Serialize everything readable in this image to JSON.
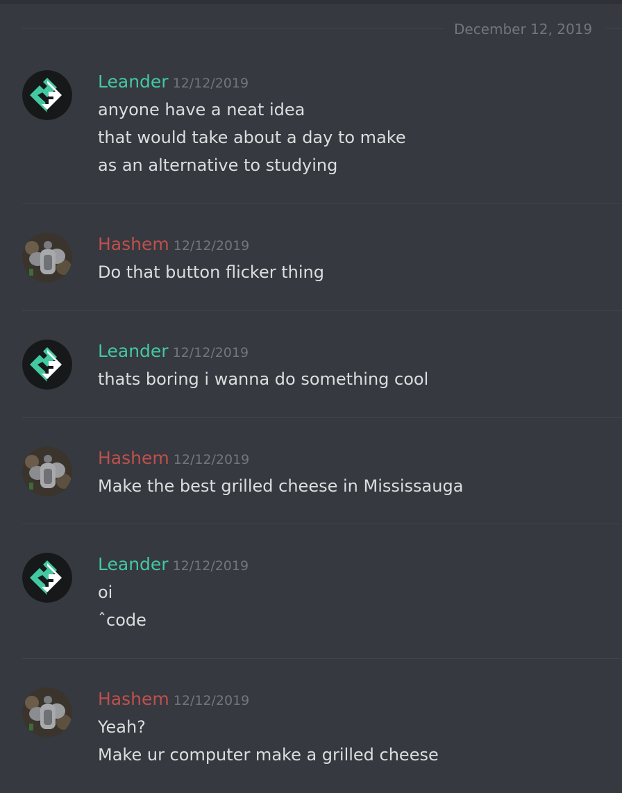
{
  "date_divider": "December 12, 2019",
  "messages": [
    {
      "author": "Leander",
      "author_color": "#43c9a1",
      "avatar": "leander-logo-avatar",
      "timestamp": "12/12/2019",
      "lines": [
        "anyone have a neat idea",
        "that would take about a day to make",
        "as an alternative to studying"
      ]
    },
    {
      "author": "Hashem",
      "author_color": "#c0504d",
      "avatar": "hashem-armor-avatar",
      "timestamp": "12/12/2019",
      "lines": [
        "Do that button flicker thing"
      ]
    },
    {
      "author": "Leander",
      "author_color": "#43c9a1",
      "avatar": "leander-logo-avatar",
      "timestamp": "12/12/2019",
      "lines": [
        "thats boring i wanna do something cool"
      ]
    },
    {
      "author": "Hashem",
      "author_color": "#c0504d",
      "avatar": "hashem-armor-avatar",
      "timestamp": "12/12/2019",
      "lines": [
        "Make the best grilled cheese in Mississauga"
      ]
    },
    {
      "author": "Leander",
      "author_color": "#43c9a1",
      "avatar": "leander-logo-avatar",
      "timestamp": "12/12/2019",
      "lines": [
        "oi",
        "ˆcode"
      ]
    },
    {
      "author": "Hashem",
      "author_color": "#c0504d",
      "avatar": "hashem-armor-avatar",
      "timestamp": "12/12/2019",
      "lines": [
        "Yeah?",
        "Make ur computer make a grilled cheese"
      ]
    }
  ]
}
